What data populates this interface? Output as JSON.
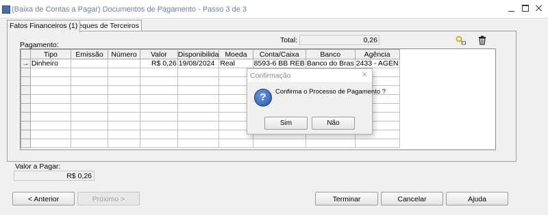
{
  "window": {
    "title": "(Baixa de Contas a Pagar) Documentos de Pagamento - Passo 3 de 3"
  },
  "tabs": [
    {
      "label": "Fatos Financeiros (1)",
      "active": true
    },
    {
      "label": "Cheques de Terceiros",
      "active": false
    }
  ],
  "labels": {
    "pagamento": "Pagamento:",
    "total": "Total:",
    "valor_a_pagar": "Valor a Pagar:"
  },
  "total_value": "0,26",
  "valor_a_pagar_value": "R$ 0,26",
  "grid": {
    "columns": [
      "Tipo",
      "Emissão",
      "Número",
      "Valor",
      "Disponibilida",
      "Moeda",
      "Conta/Caixa",
      "Banco",
      "Agência"
    ],
    "rows": [
      {
        "indicator": "→",
        "cells": [
          "Dinheiro",
          "",
          "",
          "R$ 0,26",
          "19/08/2024",
          "Real",
          "8593-6 BB REB",
          "Banco do Bras",
          "2433 - AGEN"
        ]
      }
    ]
  },
  "buttons": {
    "anterior": "< Anterior",
    "proximo": "Próximo >",
    "terminar": "Terminar",
    "cancelar": "Cancelar",
    "ajuda": "Ajuda"
  },
  "dialog": {
    "title": "Confirmação",
    "message": "Confirma o Processo de Pagamento ?",
    "sim": "Sim",
    "nao": "Não"
  },
  "icons": {
    "toolbar": [
      "key-add-icon",
      "trash-icon"
    ],
    "dialog": "question-icon"
  }
}
